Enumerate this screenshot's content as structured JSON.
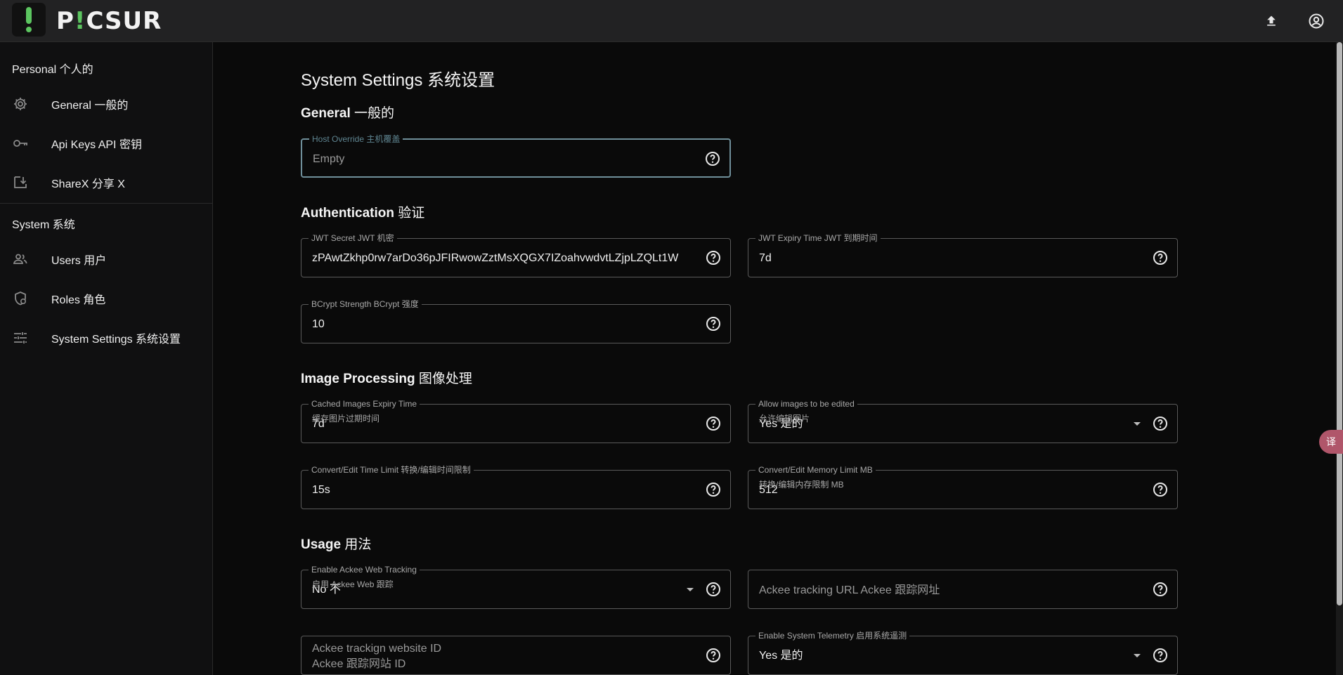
{
  "app": {
    "brand_prefix": "P",
    "brand_mark": "!",
    "brand_suffix": "CSUR"
  },
  "colors": {
    "accent": "#5cc560",
    "focus": "#6f8f9a",
    "background": "#0a0a0a"
  },
  "topbar": {
    "icons": [
      "upload-icon",
      "account-circle-icon"
    ]
  },
  "sidebar": {
    "personal_heading": "Personal  个人的",
    "system_heading": "System  系统",
    "items": [
      {
        "label": "General  一般的",
        "icon": "gear-icon"
      },
      {
        "label": "Api Keys  API 密钥",
        "icon": "key-icon"
      },
      {
        "label": "ShareX  分享 X",
        "icon": "download-icon"
      },
      {
        "label": "Users  用户",
        "icon": "users-icon"
      },
      {
        "label": "Roles  角色",
        "icon": "shield-icon"
      },
      {
        "label": "System Settings  系统设置",
        "icon": "sliders-icon"
      }
    ]
  },
  "main": {
    "title": "System Settings  系统设置",
    "sections": {
      "general": {
        "label": "General",
        "label_cn": "一般的"
      },
      "auth": {
        "label": "Authentication",
        "label_cn": "验证"
      },
      "image": {
        "label": "Image Processing",
        "label_cn": "图像处理"
      },
      "usage": {
        "label": "Usage",
        "label_cn": "用法"
      }
    },
    "fields": {
      "host_override": {
        "label": "Host Override  主机覆盖",
        "placeholder": "Empty"
      },
      "jwt_secret": {
        "label": "JWT Secret  JWT 机密",
        "value": "zPAwtZkhp0rw7arDo36pJFIRwowZztMsXQGX7IZoahvwdvtLZjpLZQLt1W"
      },
      "jwt_expiry": {
        "label": "JWT Expiry Time  JWT 到期时间",
        "value": "7d"
      },
      "bcrypt": {
        "label": "BCrypt Strength  BCrypt 强度",
        "value": "10"
      },
      "cache_expiry": {
        "label": "Cached Images Expiry Time",
        "sub": "缓存图片过期时间",
        "value": "7d"
      },
      "allow_edit": {
        "label": "Allow images to be edited",
        "sub": "允许编辑图片",
        "value": "Yes  是的"
      },
      "time_limit": {
        "label": "Convert/Edit Time Limit  转换/编辑时间限制",
        "value": "15s"
      },
      "mem_limit": {
        "label": "Convert/Edit Memory Limit MB",
        "sub": "转换/编辑内存限制 MB",
        "value": "512"
      },
      "ackee_tracking": {
        "label": "Enable Ackee Web Tracking",
        "sub": "启用 Ackee Web 跟踪",
        "value": "No  不"
      },
      "ackee_url": {
        "placeholder": "Ackee tracking URL  Ackee 跟踪网址"
      },
      "ackee_site": {
        "placeholder_1": "Ackee trackign website ID",
        "placeholder_2": "Ackee 跟踪网站 ID"
      },
      "telemetry": {
        "label": "Enable System Telemetry  启用系统遥测",
        "value": "Yes  是的"
      }
    }
  },
  "floating": {
    "label": "译"
  }
}
